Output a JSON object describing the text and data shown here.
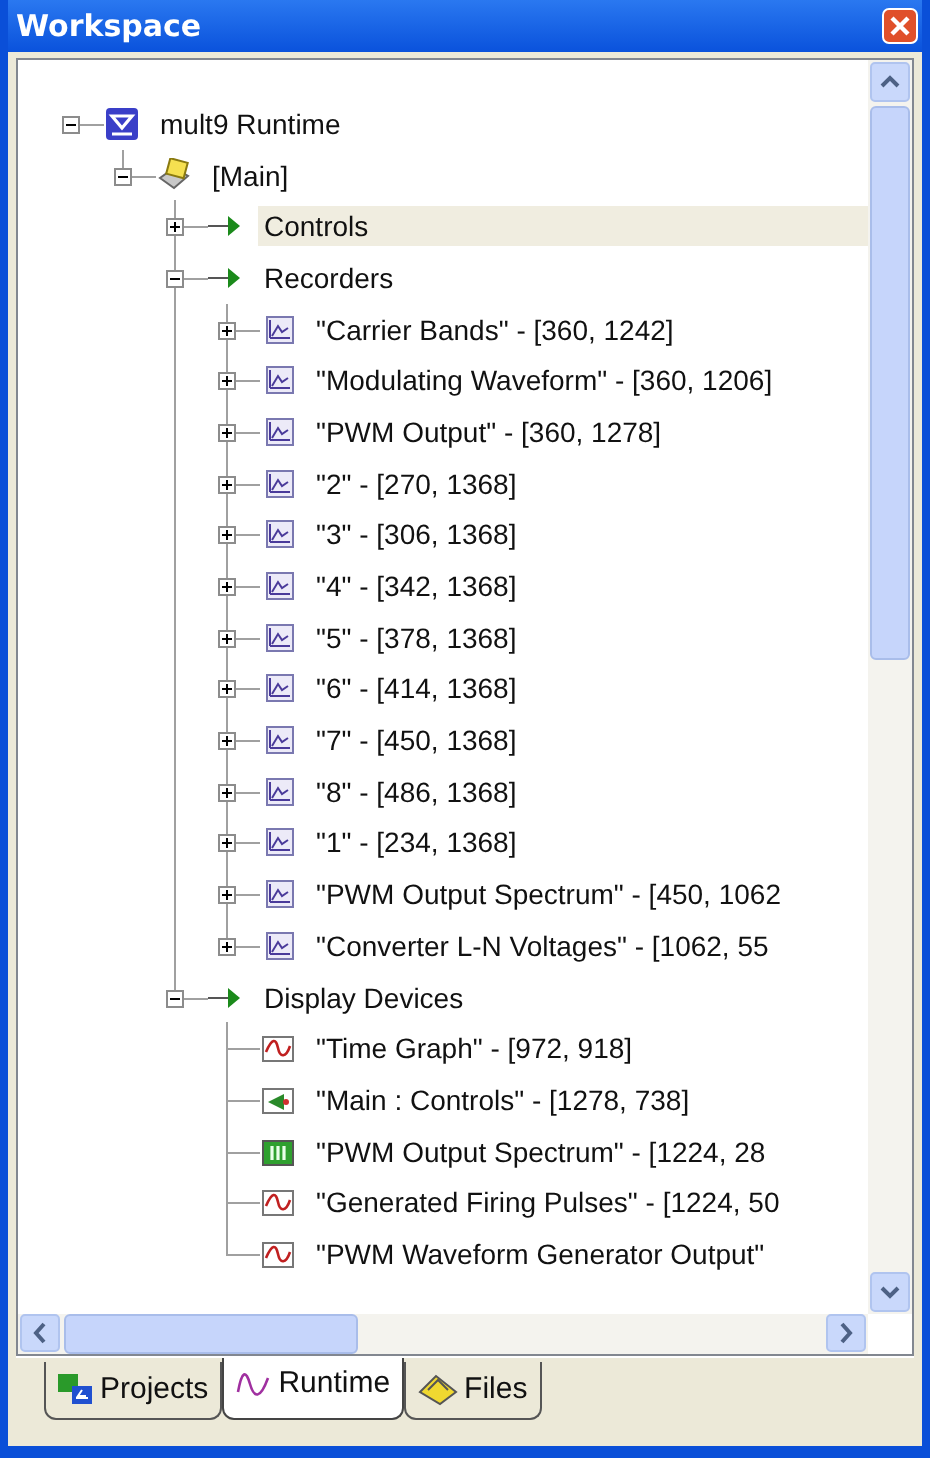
{
  "window": {
    "title": "Workspace"
  },
  "tree": [
    {
      "label": "mult9 Runtime",
      "kind": "runtime",
      "expanded": true,
      "selected": false,
      "children": [
        {
          "label": "[Main]",
          "kind": "main",
          "expanded": true,
          "selected": false,
          "children": [
            {
              "label": "Controls",
              "kind": "folder",
              "expanded": false,
              "selected": true
            },
            {
              "label": "Recorders",
              "kind": "folder",
              "expanded": true,
              "selected": false,
              "children": [
                {
                  "label": "\"Carrier Bands\" - [360, 1242]",
                  "kind": "recorder",
                  "expanded": false,
                  "selected": false
                },
                {
                  "label": "\"Modulating Waveform\" - [360, 1206]",
                  "kind": "recorder",
                  "expanded": false,
                  "selected": false
                },
                {
                  "label": "\"PWM Output\" - [360, 1278]",
                  "kind": "recorder",
                  "expanded": false,
                  "selected": false
                },
                {
                  "label": "\"2\" - [270, 1368]",
                  "kind": "recorder",
                  "expanded": false,
                  "selected": false
                },
                {
                  "label": "\"3\" - [306, 1368]",
                  "kind": "recorder",
                  "expanded": false,
                  "selected": false
                },
                {
                  "label": "\"4\" - [342, 1368]",
                  "kind": "recorder",
                  "expanded": false,
                  "selected": false
                },
                {
                  "label": "\"5\" - [378, 1368]",
                  "kind": "recorder",
                  "expanded": false,
                  "selected": false
                },
                {
                  "label": "\"6\" - [414, 1368]",
                  "kind": "recorder",
                  "expanded": false,
                  "selected": false
                },
                {
                  "label": "\"7\" - [450, 1368]",
                  "kind": "recorder",
                  "expanded": false,
                  "selected": false
                },
                {
                  "label": "\"8\" - [486, 1368]",
                  "kind": "recorder",
                  "expanded": false,
                  "selected": false
                },
                {
                  "label": "\"1\" - [234, 1368]",
                  "kind": "recorder",
                  "expanded": false,
                  "selected": false
                },
                {
                  "label": "\"PWM Output Spectrum\" - [450, 1062",
                  "kind": "recorder",
                  "expanded": false,
                  "selected": false
                },
                {
                  "label": "\"Converter L-N Voltages\" - [1062, 55",
                  "kind": "recorder",
                  "expanded": false,
                  "selected": false
                }
              ]
            },
            {
              "label": "Display Devices",
              "kind": "folder",
              "expanded": true,
              "selected": false,
              "children": [
                {
                  "label": "\"Time Graph\" - [972, 918]",
                  "kind": "graph",
                  "selected": false
                },
                {
                  "label": "\"Main : Controls\" - [1278, 738]",
                  "kind": "controls",
                  "selected": false
                },
                {
                  "label": "\"PWM Output Spectrum\" - [1224, 28",
                  "kind": "spectrum",
                  "selected": false
                },
                {
                  "label": "\"Generated Firing Pulses\" - [1224, 50",
                  "kind": "graph",
                  "selected": false
                },
                {
                  "label": "\"PWM Waveform Generator Output\"",
                  "kind": "graph",
                  "selected": false
                }
              ]
            }
          ]
        }
      ]
    }
  ],
  "tabs": [
    {
      "label": "Projects",
      "kind": "projects",
      "selected": false
    },
    {
      "label": "Runtime",
      "kind": "runtime",
      "selected": true
    },
    {
      "label": "Files",
      "kind": "files",
      "selected": false
    }
  ]
}
